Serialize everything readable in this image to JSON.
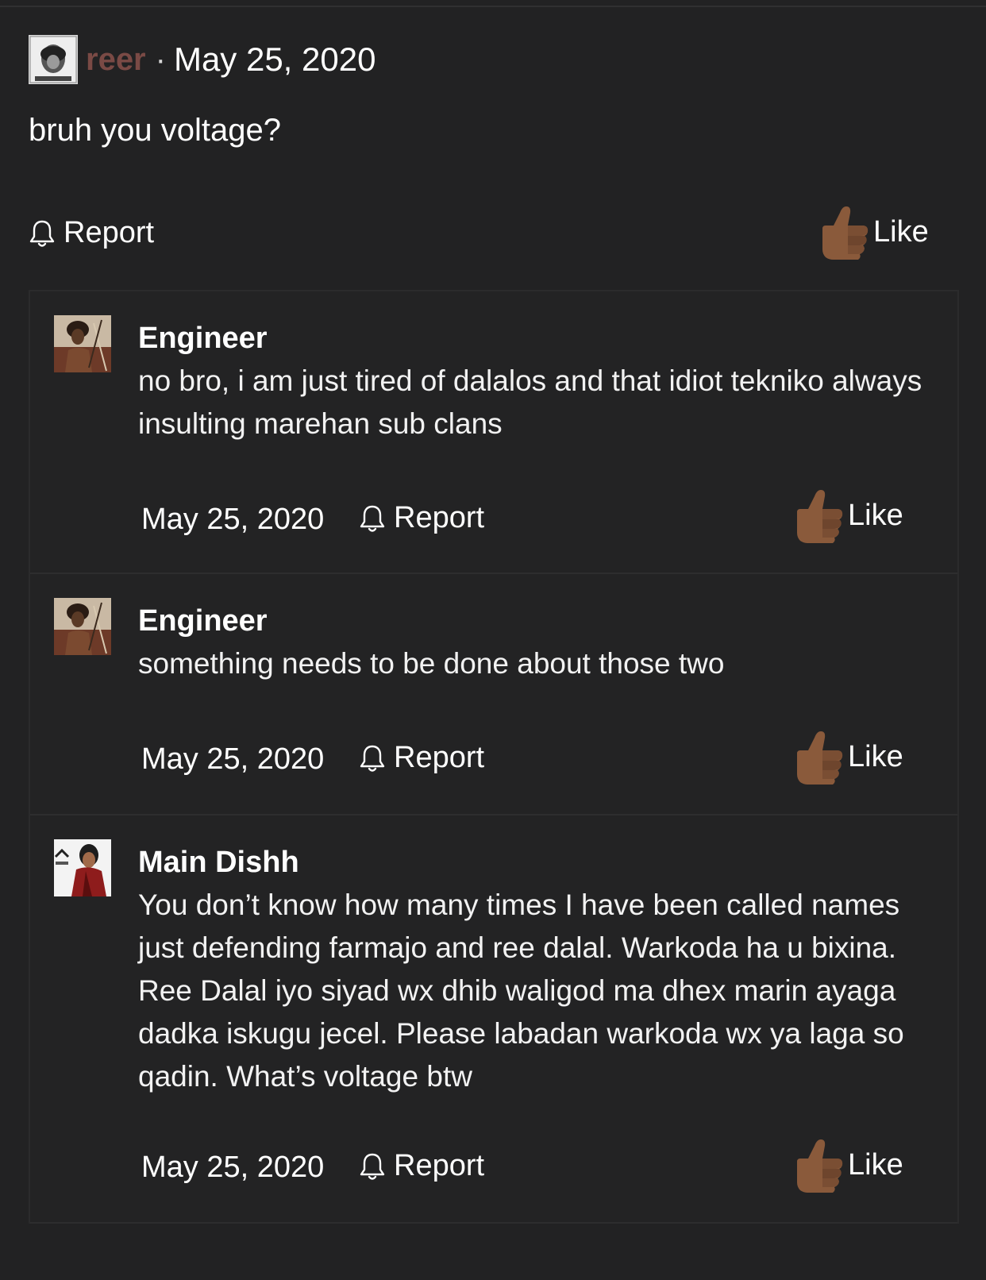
{
  "post": {
    "username": "reer",
    "separator": "·",
    "date": "May 25, 2020",
    "body": "bruh you voltage?",
    "report_label": "Report",
    "like_label": "Like"
  },
  "replies": [
    {
      "username": "Engineer",
      "text": "no bro, i am just tired of dalalos and that idiot tekniko always insulting marehan sub clans",
      "date": "May 25, 2020",
      "report_label": "Report",
      "like_label": "Like"
    },
    {
      "username": "Engineer",
      "text": "something needs to be done about those two",
      "date": "May 25, 2020",
      "report_label": "Report",
      "like_label": "Like"
    },
    {
      "username": "Main Dishh",
      "text": "You don’t know how many times I have been called names just defending farmajo and ree dalal. Warkoda ha u bixina. Ree Dalal iyo siyad wx dhib waligod ma dhex marin ayaga dadka iskugu jecel. Please labadan warkoda wx ya laga so qadin. What’s voltage btw",
      "date": "May 25, 2020",
      "report_label": "Report",
      "like_label": "Like"
    }
  ],
  "icons": {
    "report": "bell-icon",
    "like": "thumbs-up-icon"
  },
  "colors": {
    "background": "#222223",
    "username_accent": "#7a4a45",
    "thumb": "#8a5a3b"
  }
}
